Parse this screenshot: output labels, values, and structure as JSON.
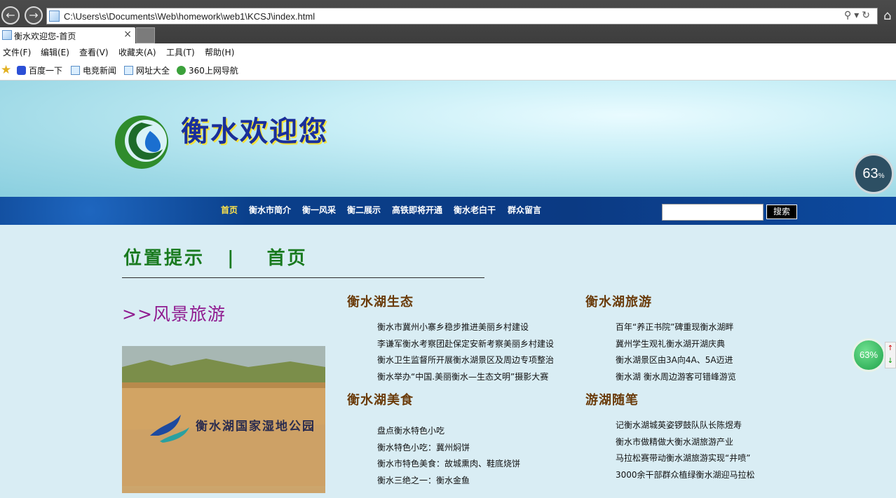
{
  "browser": {
    "url": "C:\\Users\\s\\Documents\\Web\\homework\\web1\\KCSJ\\index.html",
    "tab_title": "衡水欢迎您-首页",
    "menu": [
      "文件(F)",
      "编辑(E)",
      "查看(V)",
      "收藏夹(A)",
      "工具(T)",
      "帮助(H)"
    ],
    "favorites": [
      "百度一下",
      "电竞新闻",
      "网址大全",
      "360上网导航"
    ]
  },
  "site": {
    "title": "衡水欢迎您",
    "nav": [
      "首页",
      "衡水市简介",
      "衡一风采",
      "衡二展示",
      "高铁即将开通",
      "衡水老白干",
      "群众留言"
    ],
    "search_button": "搜索",
    "search_value": ""
  },
  "breadcrumb": {
    "label": "位置提示",
    "separator": "|",
    "current": "首页"
  },
  "sidebar": {
    "title": ">>风景旅游",
    "photo_text": "衡水湖国家湿地公园"
  },
  "sections": [
    {
      "title": "衡水湖生态",
      "links": [
        "衡水市冀州小寨乡稳步推进美丽乡村建设",
        "李谦军衡水考察团赴保定安新考察美丽乡村建设",
        "衡水卫生监督所开展衡水湖景区及周边专项整治",
        "衡水举办“中国.美丽衡水—生态文明”摄影大赛"
      ]
    },
    {
      "title": "衡水湖旅游",
      "links": [
        "百年“养正书院”碑重现衡水湖畔",
        "冀州学生观礼衡水湖开湖庆典",
        "衡水湖景区由3A向4A、5A迈进",
        "衡水湖 衡水周边游客可错峰游览"
      ]
    },
    {
      "title": "衡水湖美食",
      "links": [
        "盘点衡水特色小吃",
        "衡水特色小吃：冀州焖饼",
        "衡水市特色美食：故城熏肉、鞋底烧饼",
        "衡水三绝之一：衡水金鱼"
      ]
    },
    {
      "title": "游湖随笔",
      "links": [
        "记衡水湖城英姿锣鼓队队长陈煜寿",
        "衡水市做精做大衡水湖旅游产业",
        "马拉松赛带动衡水湖旅游实现“井喷”",
        "3000余干部群众植绿衡水湖迎马拉松"
      ]
    }
  ],
  "widgets": {
    "gauge_big": "63",
    "gauge_big_unit": "%",
    "gauge_small": "63%"
  }
}
